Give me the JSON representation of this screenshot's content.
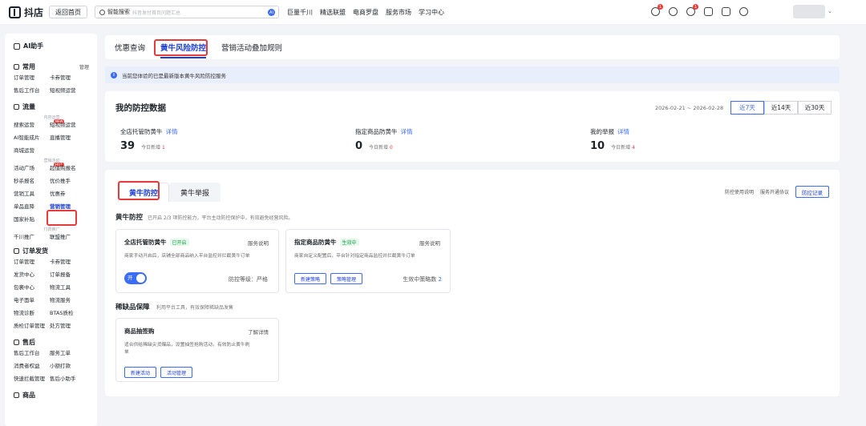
{
  "topbar": {
    "logo": "抖店",
    "back": "返回首页",
    "search_label": "智能搜索",
    "search_placeholder": "抖音发付首页问题汇总",
    "search_badge": "AI",
    "nav": [
      "巨量千川",
      "精选联盟",
      "电商罗盘",
      "服务市场",
      "学习中心"
    ],
    "badge1": "1",
    "badge2": "1"
  },
  "sidebar": {
    "ai": "AI助手",
    "common": {
      "title": "常用",
      "manage": "管理",
      "items": [
        "订单管理",
        "卡券管理",
        "售后工作台",
        "短视频运营"
      ]
    },
    "traffic": {
      "title": "流量",
      "sub1": "内容运营",
      "items1": [
        "搜索运营",
        "短视频运营",
        "AI智能成片",
        "直播管理",
        "商城运营"
      ],
      "new": "NEW",
      "sub2": "营销活动",
      "items2": [
        "活动广场",
        "超值购报名",
        "秒杀报名",
        "优价推手",
        "营销工具",
        "优惠券",
        "单品直降",
        "营销管理",
        "国家补贴"
      ],
      "hot": "HOT",
      "sub3": "付费推广",
      "items3": [
        "千川推广",
        "联盟推广"
      ]
    },
    "order": {
      "title": "订单发货",
      "items": [
        "订单管理",
        "卡券管理",
        "发货中心",
        "订单报备",
        "包裹中心",
        "物流工具",
        "电子面单",
        "物流服务",
        "物流诊断",
        "BTAS质检",
        "质检订单管理",
        "处方管理"
      ]
    },
    "after": {
      "title": "售后",
      "items": [
        "售后工作台",
        "服务工单",
        "消费者权益",
        "小额打款",
        "快速拦截管理",
        "售后小助手"
      ]
    },
    "goods": {
      "title": "商品"
    }
  },
  "tabs": [
    "优惠查询",
    "黄牛风险防控",
    "营销活动叠加规则"
  ],
  "notice": "当前您体验的已是最新版本黄牛风险防控服务",
  "data": {
    "title": "我的防控数据",
    "range": "2026-02-21 ~ 2026-02-28",
    "ranges": [
      "近7天",
      "近14天",
      "近30天"
    ],
    "stats": [
      {
        "label": "全店托管防黄牛",
        "link": "详情",
        "num": "39",
        "sub": "今日新增",
        "subnum": "1"
      },
      {
        "label": "指定商品防黄牛",
        "link": "详情",
        "num": "0",
        "sub": "今日新增",
        "subnum": "0"
      },
      {
        "label": "我的举报",
        "link": "详情",
        "num": "10",
        "sub": "今日新增",
        "subnum": "4"
      }
    ]
  },
  "main": {
    "tabs": [
      "黄牛防控",
      "黄牛举报"
    ],
    "guide": "防控使用说明",
    "agreement": "服务开通协议",
    "record": "防控记录",
    "sec1": {
      "title": "黄牛防控",
      "desc": "已开启 2/3 项防控能力，平台主动防控保护中，有效避免经营风险。"
    },
    "card1": {
      "title": "全店托管防黄牛",
      "badge": "已开启",
      "doc": "服务说明",
      "desc": "商家手动开启后，店铺全部商品纳入平台监控并拦截黄牛订单",
      "toggle": "开",
      "level_label": "防控等级：",
      "level": "严格"
    },
    "card2": {
      "title": "指定商品防黄牛",
      "badge": "生效中",
      "doc": "服务说明",
      "desc": "商家自定义配置后，平台针对指定商品监控并拦截黄牛订单",
      "btn1": "新建策略",
      "btn2": "策略管理",
      "count_label": "生效中策略数",
      "count": "2"
    },
    "sec2": {
      "title": "稀缺品保障",
      "desc": "利用平台工具，有效保障稀缺品发售"
    },
    "card3": {
      "title": "商品抽签购",
      "doc": "了解详情",
      "desc1": "适合供给稀缺尖货爆品，设置抽签抢购活动，有效防止黄牛刷",
      "desc2": "单",
      "btn1": "新建活动",
      "btn2": "活动管理"
    }
  }
}
